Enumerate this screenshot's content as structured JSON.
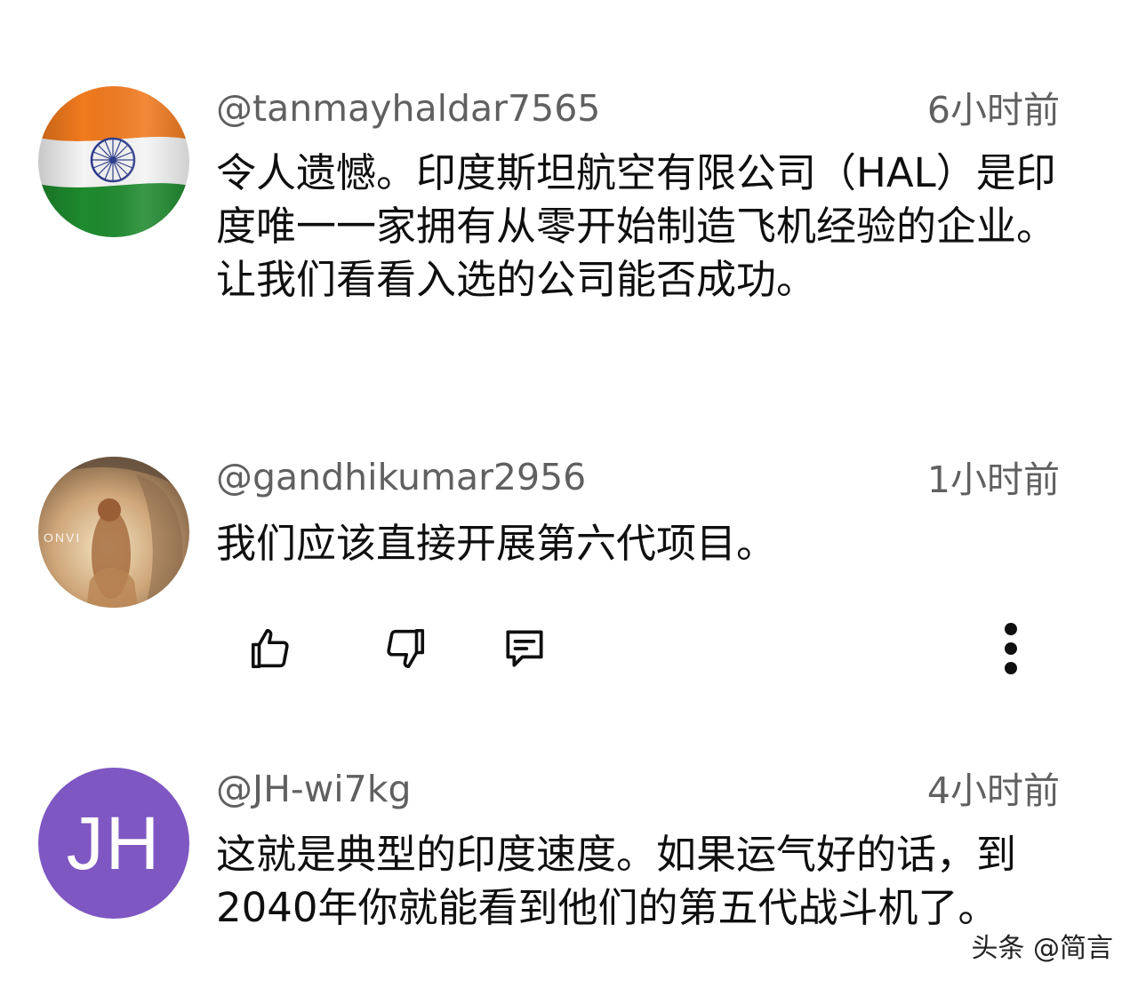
{
  "comments": [
    {
      "handle": "@tanmayhaldar7565",
      "time": "6小时前",
      "text": "令人遗憾。印度斯坦航空有限公司（HAL）是印度唯一一家拥有从零开始制造飞机经验的企业。让我们看看入选的公司能否成功。",
      "avatar": "india-flag-avatar"
    },
    {
      "handle": "@gandhikumar2956",
      "time": "1小时前",
      "text": "我们应该直接开展第六代项目。",
      "avatar": "photo-avatar"
    },
    {
      "handle": "@JH-wi7kg",
      "time": "4小时前",
      "text": "这就是典型的印度速度。如果运气好的话，到2040年你就能看到他们的第五代战斗机了。",
      "avatar_initials": "JH",
      "avatar_color": "#7e57c2"
    }
  ],
  "actions": {
    "like_icon": "thumbs-up-icon",
    "dislike_icon": "thumbs-down-icon",
    "reply_icon": "reply-icon",
    "more_icon": "more-vert-icon"
  },
  "photo_avatar_text": "ONVI",
  "watermark": "头条 @简言",
  "colors": {
    "meta_text": "#606060",
    "body_text": "#0f0f0f",
    "icon": "#0f0f0f",
    "jh_avatar": "#7e57c2"
  }
}
